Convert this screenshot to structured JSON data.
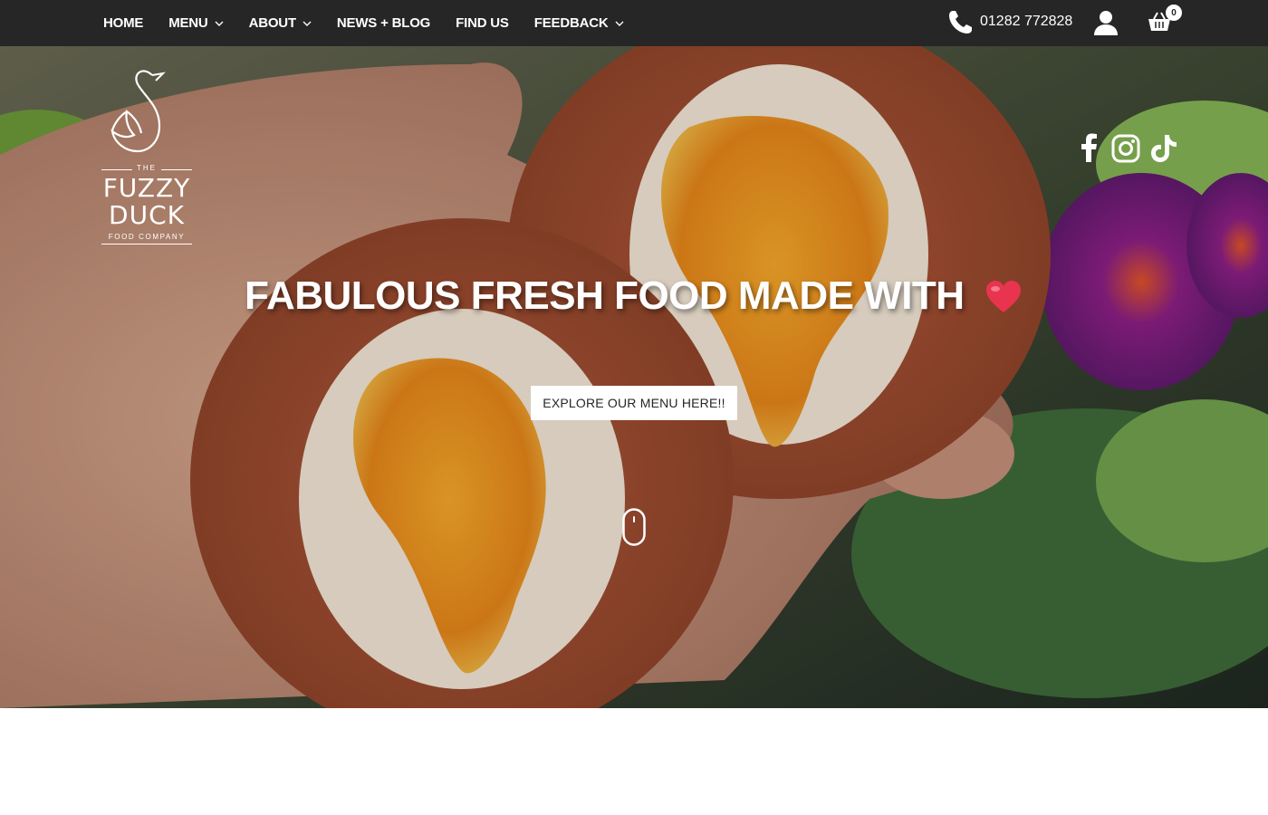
{
  "nav": {
    "items": [
      {
        "label": "HOME",
        "has_dropdown": false
      },
      {
        "label": "MENU",
        "has_dropdown": true
      },
      {
        "label": "ABOUT",
        "has_dropdown": true
      },
      {
        "label": "NEWS + BLOG",
        "has_dropdown": false
      },
      {
        "label": "FIND US",
        "has_dropdown": false
      },
      {
        "label": "FEEDBACK",
        "has_dropdown": true
      }
    ],
    "phone": "01282 772828",
    "cart_count": "0"
  },
  "logo": {
    "the": "THE",
    "line1": "FUZZY",
    "line2": "DUCK",
    "subtitle": "FOOD COMPANY"
  },
  "hero": {
    "headline": "FABULOUS FRESH FOOD MADE WITH",
    "cta_label": "EXPLORE OUR MENU HERE!!"
  },
  "social": [
    "facebook-icon",
    "instagram-icon",
    "tiktok-icon"
  ],
  "colors": {
    "topbar": "#262626",
    "text": "#ffffff",
    "heart": "#e8344f"
  }
}
